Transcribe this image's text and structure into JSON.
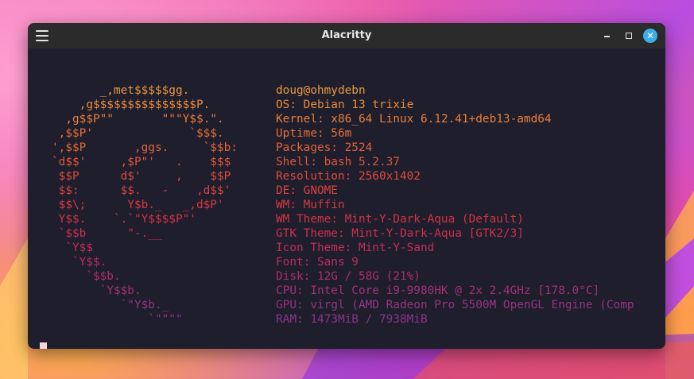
{
  "window": {
    "title": "Alacritty"
  },
  "icons": {
    "menu": "hamburger-menu-icon",
    "minimize": "minimize-icon",
    "maximize": "maximize-icon",
    "close": "close-icon"
  },
  "colors": {
    "close_button": "#3daee9",
    "terminal_bg": "#1f1e2c",
    "titlebar_bg": "#2b2b2b"
  },
  "terminal": {
    "logo_lines": [
      {
        "text": "       _,met$$$$$gg.",
        "color": "#e8993e"
      },
      {
        "text": "    ,g$$$$$$$$$$$$$$$P.",
        "color": "#e88b3c"
      },
      {
        "text": "  ,g$$P\"\"       \"\"\"Y$$.\".",
        "color": "#e77e3b"
      },
      {
        "text": " ,$$P'              `$$$.",
        "color": "#e5703b"
      },
      {
        "text": "',$$P       ,ggs.     `$$b:",
        "color": "#e3633b"
      },
      {
        "text": "`d$$'     ,$P\"'   .    $$$",
        "color": "#e0573c"
      },
      {
        "text": " $$P      d$'     ,    $$P",
        "color": "#dd4b3d"
      },
      {
        "text": " $$:      $$.   -    ,d$$'",
        "color": "#d9423f"
      },
      {
        "text": " $$\\;      Y$b._   _,d$P'",
        "color": "#d53a42"
      },
      {
        "text": " Y$$.    `.`\"Y$$$$P\"'",
        "color": "#d03446"
      },
      {
        "text": " `$$b      \"-.__",
        "color": "#ca304d"
      },
      {
        "text": "  `Y$$",
        "color": "#c22e57"
      },
      {
        "text": "   `Y$$.",
        "color": "#b82e62"
      },
      {
        "text": "     `$$b.",
        "color": "#ad2f6d"
      },
      {
        "text": "       `Y$$b.",
        "color": "#a13178"
      },
      {
        "text": "          `\"Y$b._",
        "color": "#953382"
      },
      {
        "text": "              `\"\"\"\"",
        "color": "#8a348b"
      }
    ],
    "info_lines": [
      {
        "text": "doug@ohmydebn",
        "color": "#e8993e"
      },
      {
        "text": "OS: Debian 13 trixie",
        "color": "#e88b3c"
      },
      {
        "text": "Kernel: x86_64 Linux 6.12.41+deb13-amd64",
        "color": "#e77e3b"
      },
      {
        "text": "Uptime: 56m",
        "color": "#e5703b"
      },
      {
        "text": "Packages: 2524",
        "color": "#e3633b"
      },
      {
        "text": "Shell: bash 5.2.37",
        "color": "#e0573c"
      },
      {
        "text": "Resolution: 2560x1402",
        "color": "#dd4b3d"
      },
      {
        "text": "DE: GNOME",
        "color": "#d9423f"
      },
      {
        "text": "WM: Muffin",
        "color": "#d53a42"
      },
      {
        "text": "WM Theme: Mint-Y-Dark-Aqua (Default)",
        "color": "#d03446"
      },
      {
        "text": "GTK Theme: Mint-Y-Dark-Aqua [GTK2/3]",
        "color": "#ca304d"
      },
      {
        "text": "Icon Theme: Mint-Y-Sand",
        "color": "#c22e57"
      },
      {
        "text": "Font: Sans 9",
        "color": "#b82e62"
      },
      {
        "text": "Disk: 12G / 58G (21%)",
        "color": "#ad2f6d"
      },
      {
        "text": "CPU: Intel Core i9-9980HK @ 2x 2.4GHz [178.0°C]",
        "color": "#a13178"
      },
      {
        "text": "GPU: virgl (AMD Radeon Pro 5500M OpenGL Engine (Comp",
        "color": "#953382"
      },
      {
        "text": "RAM: 1473MiB / 7938MiB",
        "color": "#8a348b"
      }
    ]
  }
}
